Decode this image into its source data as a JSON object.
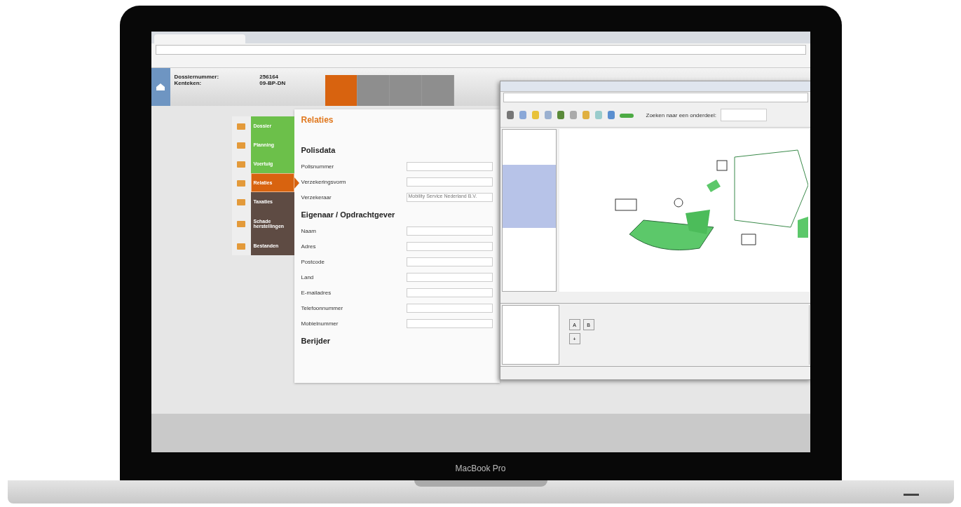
{
  "laptop": {
    "brand_label": "MacBook Pro"
  },
  "app_header": {
    "dossier_label": "Dossiernummer:",
    "dossier_value": "256164",
    "plate_label": "Kenteken:",
    "plate_value": "09-BP-DN",
    "nav_tabs": [
      {
        "selected": true
      },
      {
        "selected": false
      },
      {
        "selected": false
      },
      {
        "selected": false
      }
    ]
  },
  "side_menu": [
    {
      "label": "Dossier",
      "color": "#6cc04a",
      "selected": false
    },
    {
      "label": "Planning",
      "color": "#6cc04a",
      "selected": false
    },
    {
      "label": "Voertuig",
      "color": "#6cc04a",
      "selected": false
    },
    {
      "label": "Relaties",
      "color": "#d8630f",
      "selected": true
    },
    {
      "label": "Taxaties",
      "color": "#5e4b43",
      "selected": false
    },
    {
      "label": "Schade herstellingen",
      "color": "#5e4b43",
      "selected": false
    },
    {
      "label": "Bestanden",
      "color": "#5e4b43",
      "selected": false
    }
  ],
  "form": {
    "title": "Relaties",
    "sections": [
      {
        "heading": "Polisdata",
        "fields": [
          {
            "label": "Polisnummer"
          },
          {
            "label": "Verzekeringsvorm"
          },
          {
            "label": "Verzekeraar",
            "value": "Mobility Service Nederland B.V."
          }
        ]
      },
      {
        "heading": "Eigenaar / Opdrachtgever",
        "fields": [
          {
            "label": "Naam"
          },
          {
            "label": "Adres"
          },
          {
            "label": "Postcode"
          },
          {
            "label": "Land"
          },
          {
            "label": "E-mailadres"
          },
          {
            "label": "Telefoonnummer"
          },
          {
            "label": "Mobielnummer"
          }
        ]
      },
      {
        "heading": "Berijder"
      }
    ]
  },
  "popup": {
    "search_label": "Zoeken naar een onderdeel:",
    "group_buttons": [
      "A",
      "B",
      "+"
    ]
  }
}
